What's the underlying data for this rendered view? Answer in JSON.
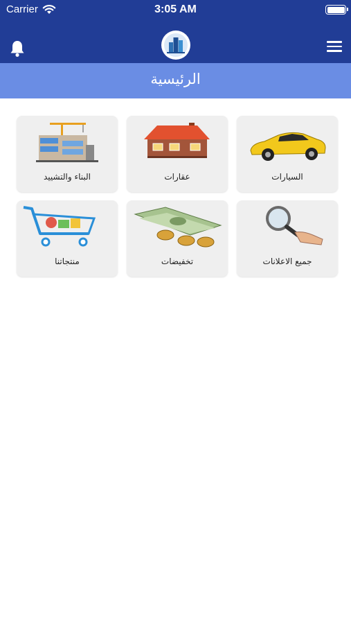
{
  "status_bar": {
    "carrier": "Carrier",
    "time": "3:05 AM"
  },
  "nav": {
    "bell_icon": "bell-icon",
    "logo_icon": "buildings-logo",
    "menu_icon": "hamburger-menu-icon"
  },
  "title": "الرئيسية",
  "categories": [
    {
      "label": "السيارات",
      "icon": "car-icon"
    },
    {
      "label": "عقارات",
      "icon": "house-icon"
    },
    {
      "label": "البناء والتشييد",
      "icon": "construction-icon"
    },
    {
      "label": "جميع الاعلانات",
      "icon": "magnifier-icon"
    },
    {
      "label": "تخفيضات",
      "icon": "money-icon"
    },
    {
      "label": "منتجاتنا",
      "icon": "shopping-cart-icon"
    }
  ],
  "colors": {
    "nav_bar": "#213d96",
    "title_bar": "#6a8de4",
    "card_bg": "#efefef"
  }
}
